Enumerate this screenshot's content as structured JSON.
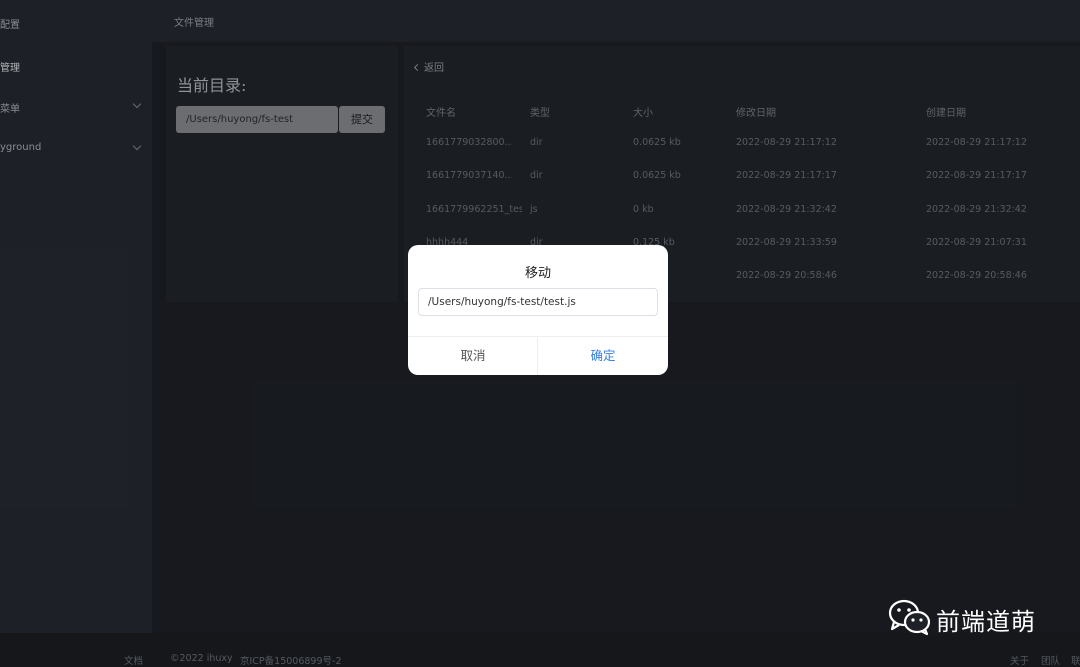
{
  "sidebar": {
    "items": [
      {
        "label": "配置"
      },
      {
        "label": "管理"
      },
      {
        "label": "菜单"
      },
      {
        "label": "yground"
      }
    ]
  },
  "topbar": {
    "title": "文件管理"
  },
  "left_panel": {
    "title": "当前目录:",
    "path_value": "/Users/huyong/fs-test",
    "submit_label": "提交"
  },
  "file_table": {
    "back_label": "返回",
    "headers": [
      "文件名",
      "类型",
      "大小",
      "修改日期",
      "创建日期"
    ],
    "rows": [
      [
        "1661779032800...",
        "dir",
        "0.0625 kb",
        "2022-08-29 21:17:12",
        "2022-08-29 21:17:12"
      ],
      [
        "1661779037140...",
        "dir",
        "0.0625 kb",
        "2022-08-29 21:17:17",
        "2022-08-29 21:17:17"
      ],
      [
        "1661779962251_tes",
        "js",
        "0 kb",
        "2022-08-29 21:32:42",
        "2022-08-29 21:32:42"
      ],
      [
        "hhhh444",
        "dir",
        "0.125 kb",
        "2022-08-29 21:33:59",
        "2022-08-29 21:07:31"
      ],
      [
        "",
        "",
        "",
        "2022-08-29 20:58:46",
        "2022-08-29 20:58:46"
      ]
    ]
  },
  "dialog": {
    "title": "移动",
    "input_value": "/Users/huyong/fs-test/test.js",
    "cancel_label": "取消",
    "confirm_label": "确定",
    "confirm_color": "#3a7fe0"
  },
  "footer": {
    "docs": "文档",
    "copyright": "©2022 ihuxy",
    "icp": "京ICP备15006899号-2",
    "about": "关于",
    "team": "团队",
    "more": "联"
  },
  "watermark": {
    "text": "前端道萌"
  }
}
